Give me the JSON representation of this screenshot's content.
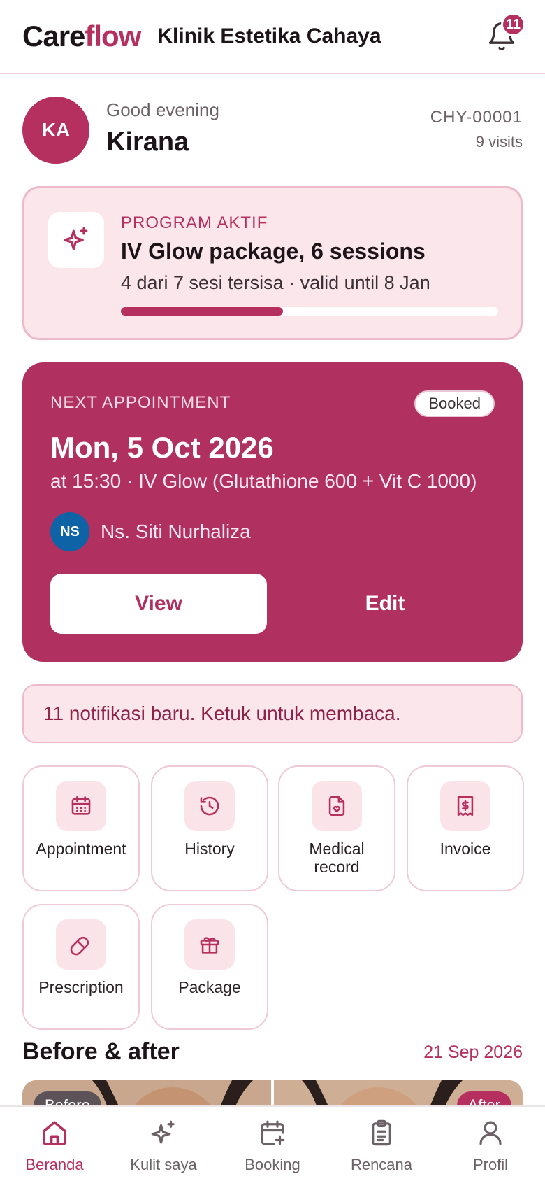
{
  "header": {
    "brand_part1": "Care",
    "brand_part2": "flow",
    "clinic_name": "Klinik Estetika Cahaya",
    "notification_count": "11"
  },
  "greeting": {
    "initials": "KA",
    "salutation": "Good evening",
    "name": "Kirana",
    "patient_id": "CHY-00001",
    "visits": "9 visits"
  },
  "program": {
    "label": "PROGRAM AKTIF",
    "title": "IV Glow package, 6 sessions",
    "subtitle": "4 dari 7 sesi tersisa · valid until 8 Jan",
    "progress_fraction": 0.43
  },
  "appointment": {
    "label": "NEXT APPOINTMENT",
    "status": "Booked",
    "date": "Mon, 5 Oct 2026",
    "detail": "at 15:30 · IV Glow (Glutathione 600 + Vit C 1000)",
    "nurse_initials": "NS",
    "nurse_name": "Ns. Siti Nurhaliza",
    "view_label": "View",
    "edit_label": "Edit"
  },
  "notification_banner": "11 notifikasi baru. Ketuk untuk membaca.",
  "quick_actions": [
    {
      "label": "Appointment",
      "icon": "calendar-icon"
    },
    {
      "label": "History",
      "icon": "history-icon"
    },
    {
      "label": "Medical record",
      "icon": "medical-record-icon"
    },
    {
      "label": "Invoice",
      "icon": "invoice-icon"
    },
    {
      "label": "Prescription",
      "icon": "pill-icon"
    },
    {
      "label": "Package",
      "icon": "gift-icon"
    }
  ],
  "before_after": {
    "title": "Before & after",
    "date": "21 Sep 2026",
    "before_tag": "Before",
    "after_tag": "After"
  },
  "nav": [
    {
      "label": "Beranda",
      "icon": "home-icon",
      "active": true
    },
    {
      "label": "Kulit saya",
      "icon": "sparkle-icon",
      "active": false
    },
    {
      "label": "Booking",
      "icon": "calendar-plus-icon",
      "active": false
    },
    {
      "label": "Rencana",
      "icon": "clipboard-icon",
      "active": false
    },
    {
      "label": "Profil",
      "icon": "user-icon",
      "active": false
    }
  ],
  "colors": {
    "accent": "#b5305f",
    "accent_light": "#fbe6ec",
    "nurse_avatar": "#0e62a6"
  }
}
